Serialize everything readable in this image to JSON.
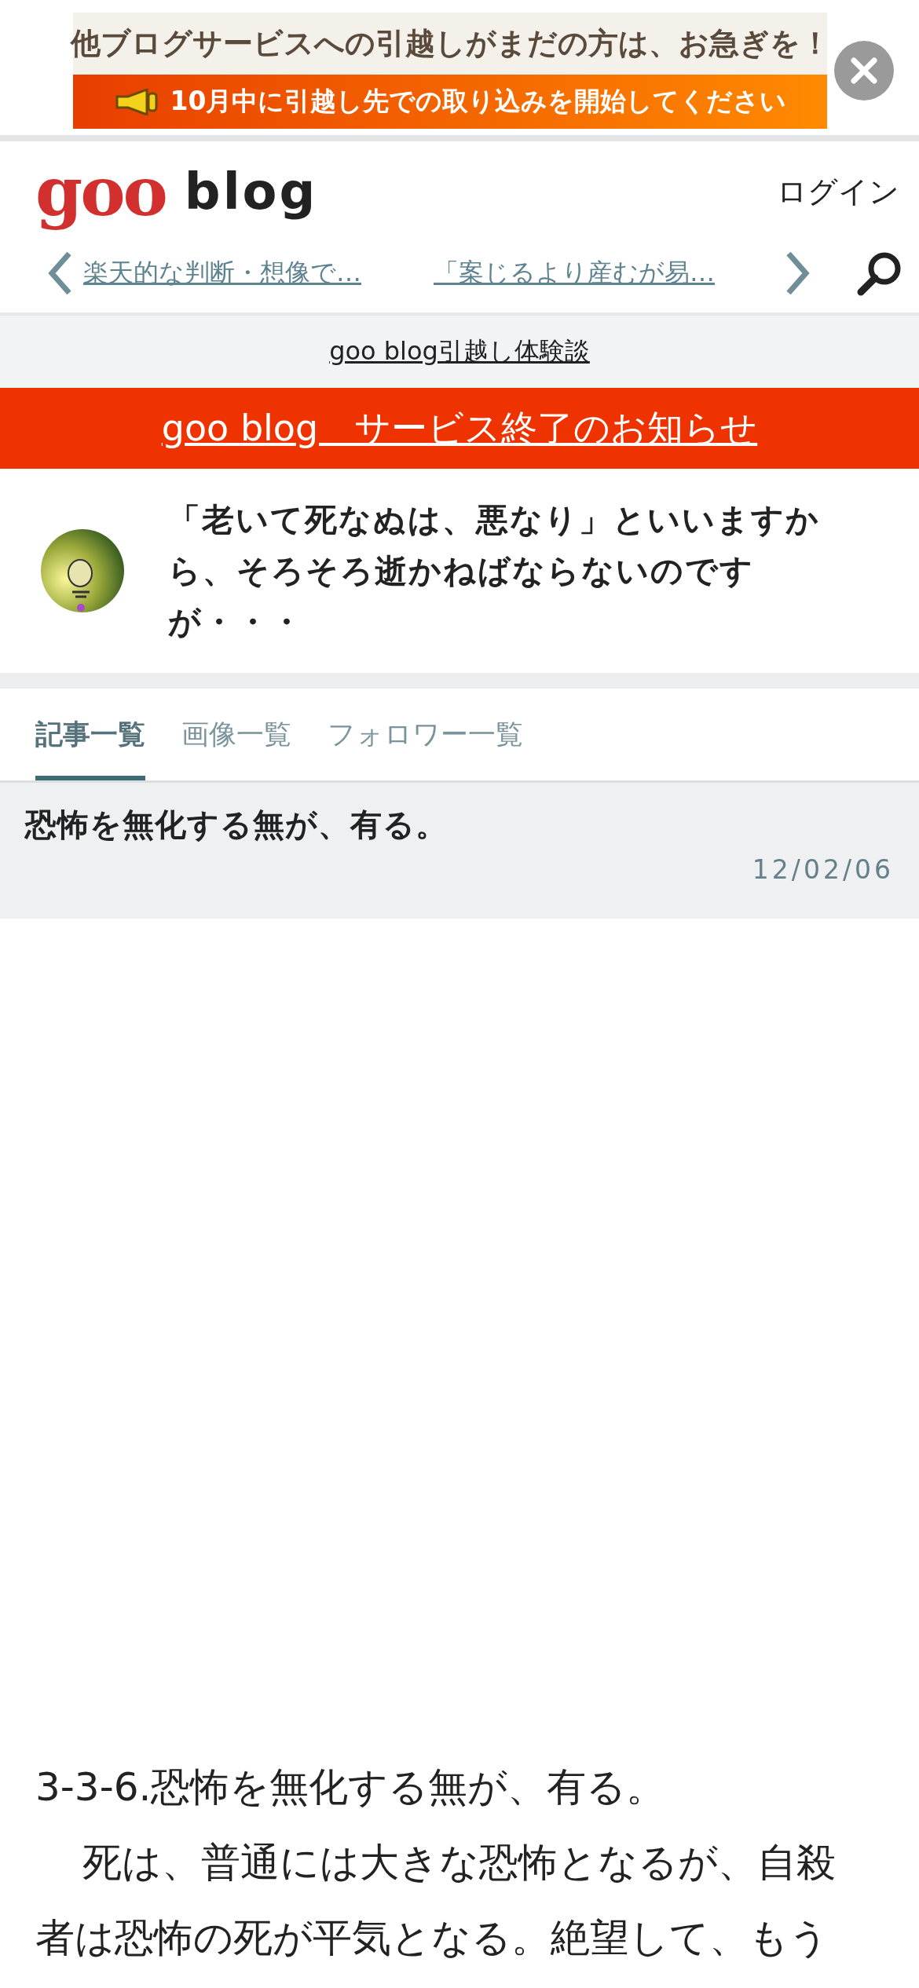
{
  "ad_banner": {
    "headline": "他ブログサービスへの引越しがまだの方は、お急ぎを！",
    "subline": "10月中に引越し先での取り込みを開始してください"
  },
  "header": {
    "logo": {
      "brand": "goo",
      "suffix": "blog"
    },
    "login": "ログイン"
  },
  "article_nav": {
    "previous": "楽天的な判断・想像で…",
    "next": "「案じるより産むが易…"
  },
  "notice_link": "goo blog引越し体験談",
  "alert_bar": "goo blog　サービス終了のお知らせ",
  "profile": {
    "title": "「老いて死なぬは、悪なり」といいますから、そろそろ逝かねばならないのですが・・・"
  },
  "tabs": [
    {
      "label": "記事一覧",
      "selected": true
    },
    {
      "label": "画像一覧",
      "selected": false
    },
    {
      "label": "フォロワー一覧",
      "selected": false
    }
  ],
  "article": {
    "title": "恐怖を無化する無が、有る。",
    "date": "12/02/06",
    "heading": "3-3-6.恐怖を無化する無が、有る。",
    "paragraph": "死は、普通には大きな恐怖となるが、自殺者は恐怖の死が平気となる。絶望して、もう"
  }
}
